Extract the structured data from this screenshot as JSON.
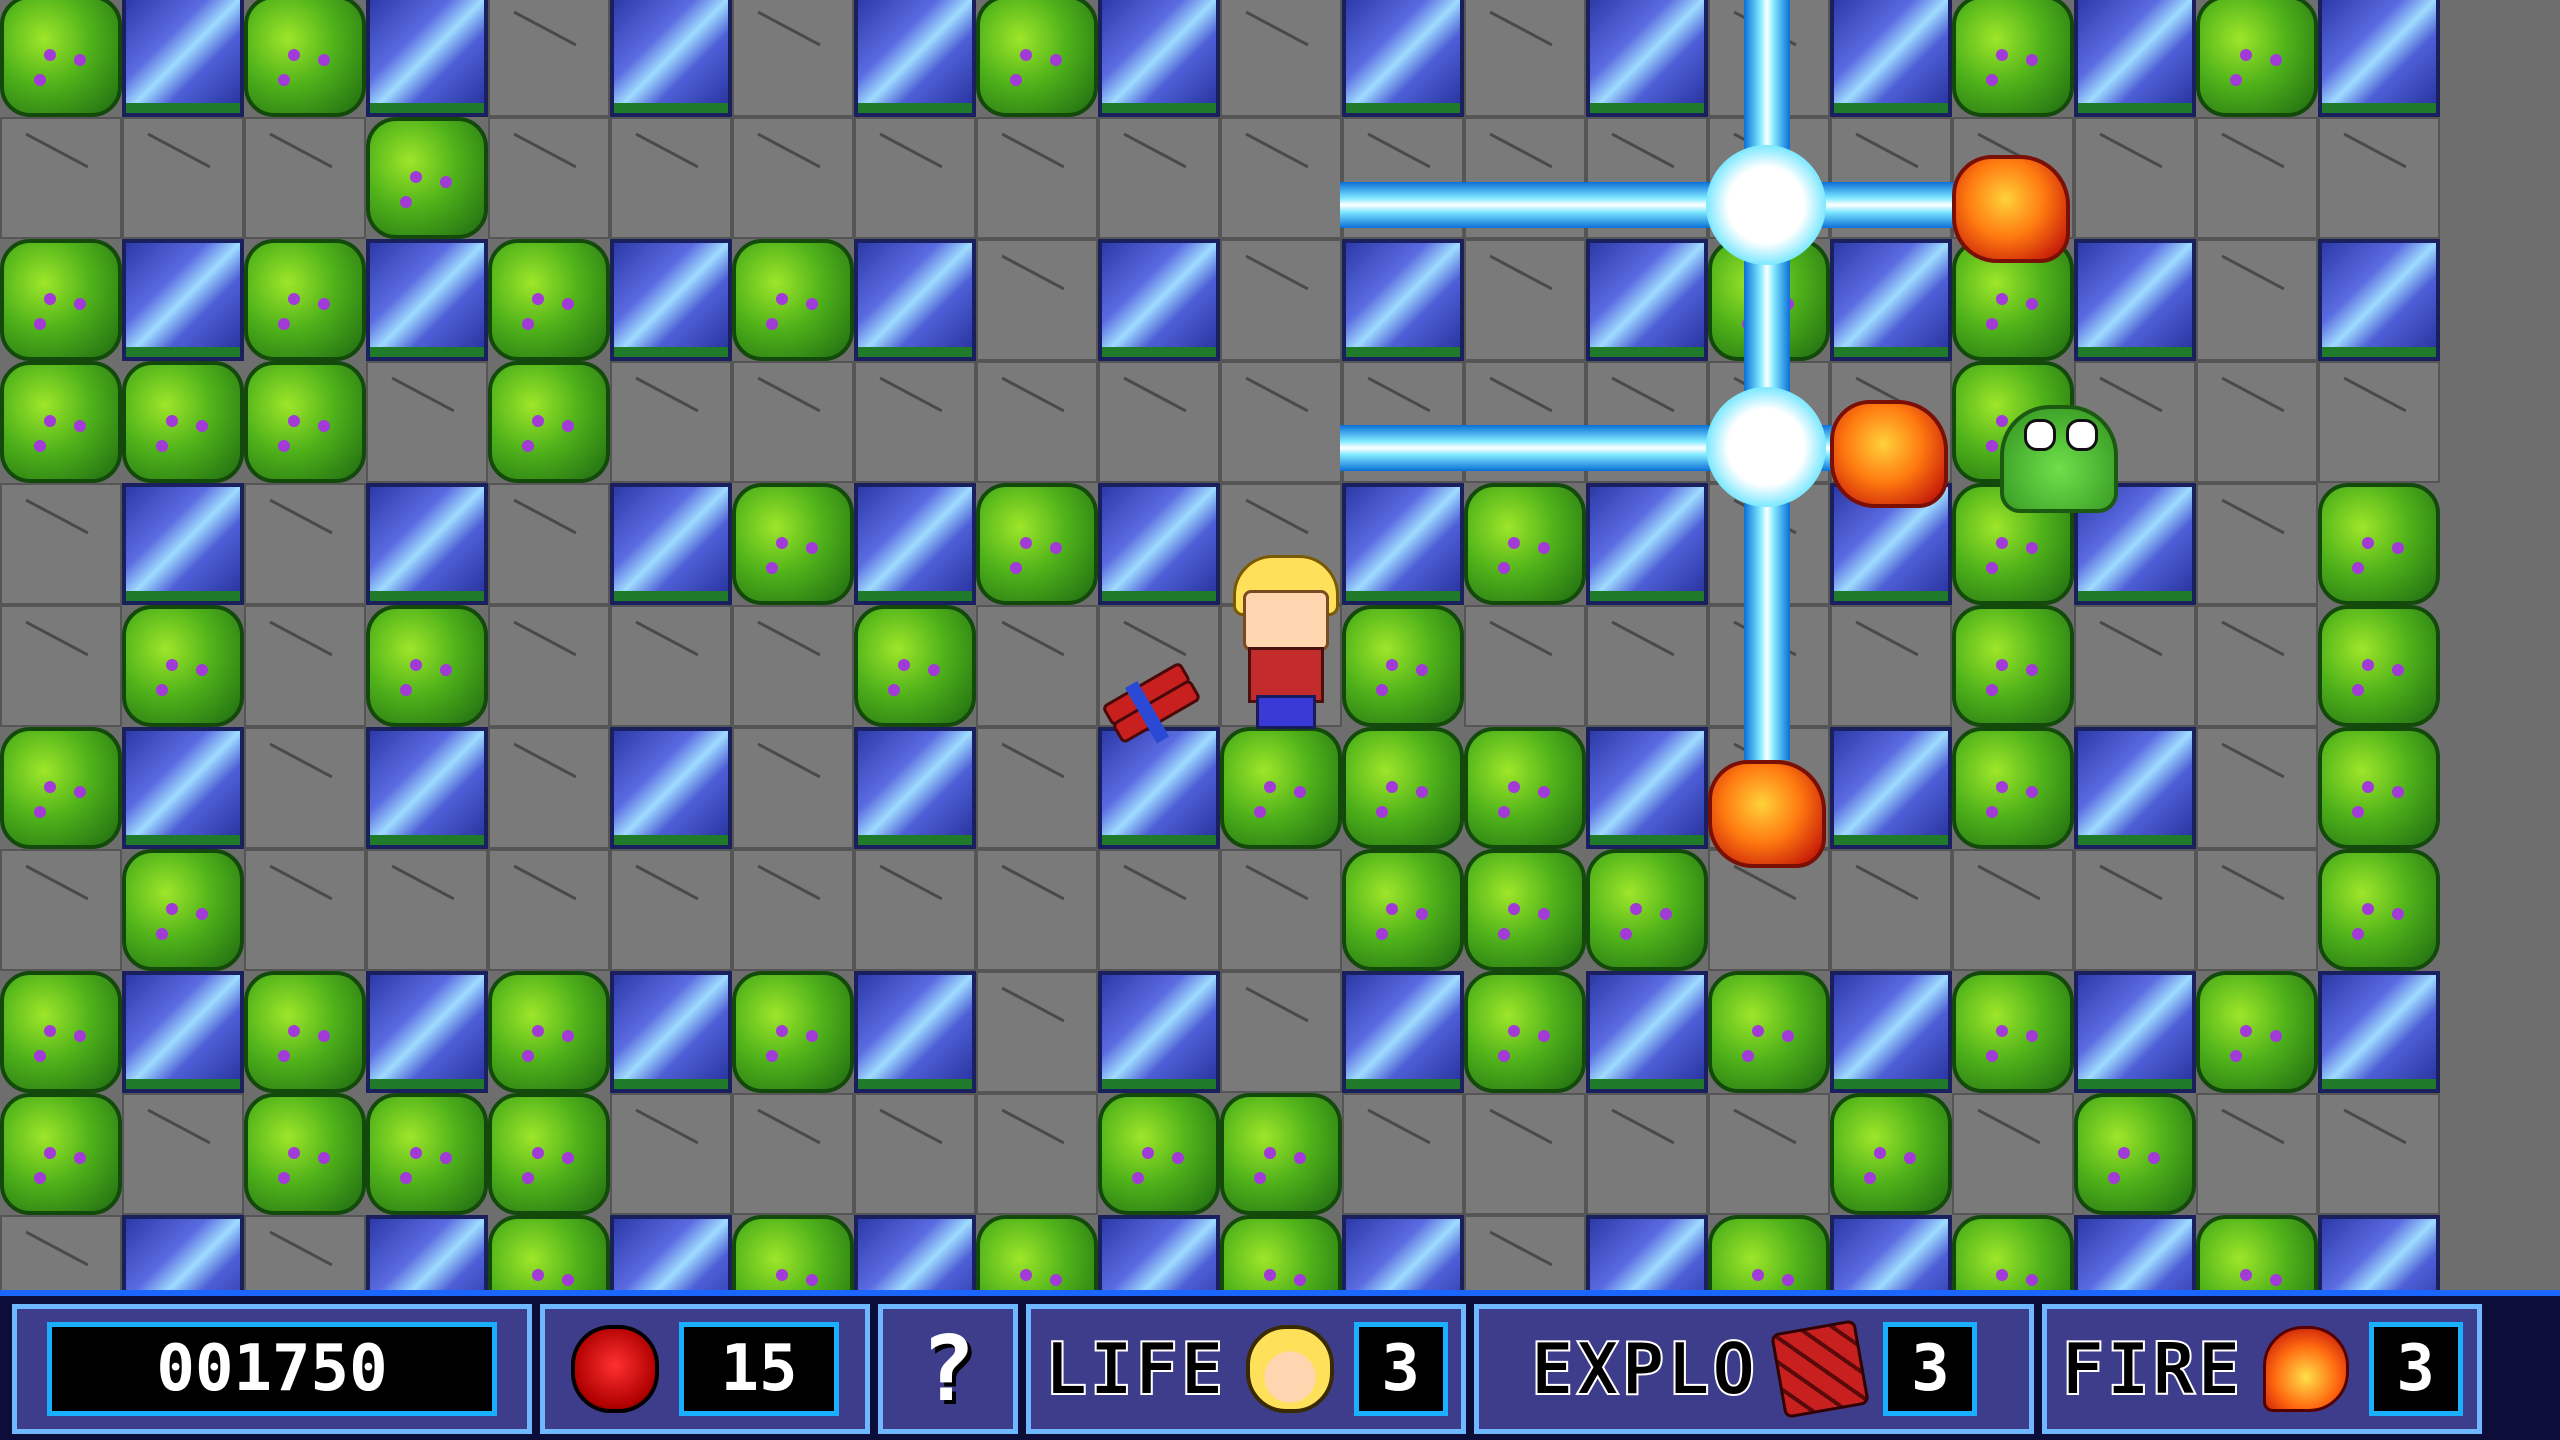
{
  "hud": {
    "score": "001750",
    "enemies_icon": "skull-icon",
    "enemies_left": "15",
    "mystery_item": "?",
    "life_label": "LIFE",
    "life_icon": "player-face-icon",
    "life_count": "3",
    "explo_label": "EXPLO",
    "explo_icon": "dynamite-icon",
    "explo_count": "3",
    "fire_label": "FIRE",
    "fire_icon": "fire-icon",
    "fire_count": "3"
  },
  "colors": {
    "hud_background": "#0d0d3a",
    "hud_border": "#1a66ff",
    "panel": "#3d3d8c",
    "floor": "#7a7a7a",
    "wall": "#4e5fd6",
    "bush": "#4fb21a",
    "beam": "#7fe8ff",
    "fire": "#ff7a10"
  }
}
